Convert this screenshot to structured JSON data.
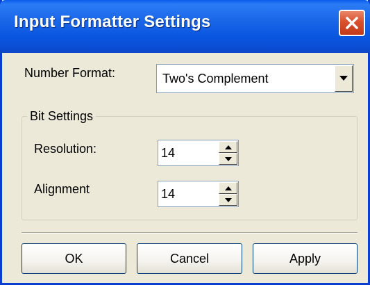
{
  "window": {
    "title": "Input Formatter Settings"
  },
  "number_format": {
    "label": "Number Format:",
    "selected": "Two's Complement"
  },
  "bit_settings": {
    "group_label": "Bit Settings",
    "resolution": {
      "label": "Resolution:",
      "value": "14"
    },
    "alignment": {
      "label": "Alignment",
      "value": "14"
    }
  },
  "buttons": {
    "ok": "OK",
    "cancel": "Cancel",
    "apply": "Apply"
  },
  "icons": {
    "close": "close-icon",
    "dropdown": "chevron-down-icon",
    "spin_up": "spin-up-icon",
    "spin_down": "spin-down-icon"
  },
  "colors": {
    "titlebar": "#0A55DF",
    "close_button": "#D9502C",
    "dialog_background": "#ECE9D8",
    "button_border": "#003C74"
  }
}
